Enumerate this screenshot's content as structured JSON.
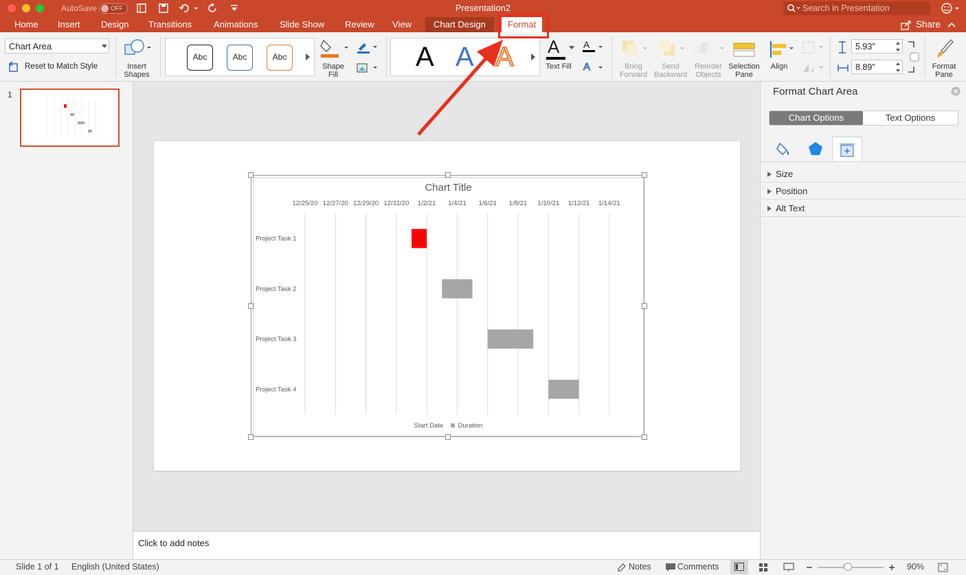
{
  "window": {
    "title": "Presentation2",
    "autosave_label": "AutoSave",
    "autosave_state": "OFF",
    "search_placeholder": "Search in Presentation",
    "share_label": "Share"
  },
  "tabs": [
    "Home",
    "Insert",
    "Design",
    "Transitions",
    "Animations",
    "Slide Show",
    "Review",
    "View",
    "Chart Design",
    "Format"
  ],
  "ribbon": {
    "element_selector": "Chart Area",
    "reset_label": "Reset to Match Style",
    "insert_shapes": "Insert\nShapes",
    "style_sample": "Abc",
    "shape_fill": "Shape\nFill",
    "wordart_letter": "A",
    "text_fill": "Text Fill",
    "bring_forward": "Bring\nForward",
    "send_backward": "Send\nBackward",
    "reorder_objects": "Reorder\nObjects",
    "selection_pane": "Selection\nPane",
    "align": "Align",
    "height": "5.93\"",
    "width": "8.89\"",
    "format_pane": "Format\nPane"
  },
  "thumbnail": {
    "number": "1"
  },
  "chart_data": {
    "type": "bar",
    "title": "Chart Title",
    "x_ticks": [
      "12/25/20",
      "12/27/20",
      "12/29/20",
      "12/31/20",
      "1/2/21",
      "1/4/21",
      "1/6/21",
      "1/8/21",
      "1/10/21",
      "1/12/21",
      "1/14/21"
    ],
    "categories": [
      "Project Task 1",
      "Project Task 2",
      "Project Task 3",
      "Project Task 4"
    ],
    "series": [
      {
        "name": "Start Date",
        "values": [
          "2021-01-01",
          "2021-01-03",
          "2021-01-06",
          "2021-01-10"
        ]
      },
      {
        "name": "Duration",
        "values": [
          1,
          2,
          3,
          2
        ]
      }
    ],
    "highlight_color": "#ff0000",
    "duration_color": "#a6a6a6",
    "xlim": [
      "2020-12-25",
      "2021-01-15"
    ],
    "legend": "bottom",
    "grid": true
  },
  "notes_placeholder": "Click to add notes",
  "format_pane": {
    "title": "Format Chart Area",
    "tabs": [
      "Chart Options",
      "Text Options"
    ],
    "sections": [
      "Size",
      "Position",
      "Alt Text"
    ]
  },
  "status": {
    "slide": "Slide 1 of 1",
    "language": "English (United States)",
    "notes": "Notes",
    "comments": "Comments",
    "zoom": "90%"
  },
  "annotation": {
    "color": "#e8301c"
  }
}
